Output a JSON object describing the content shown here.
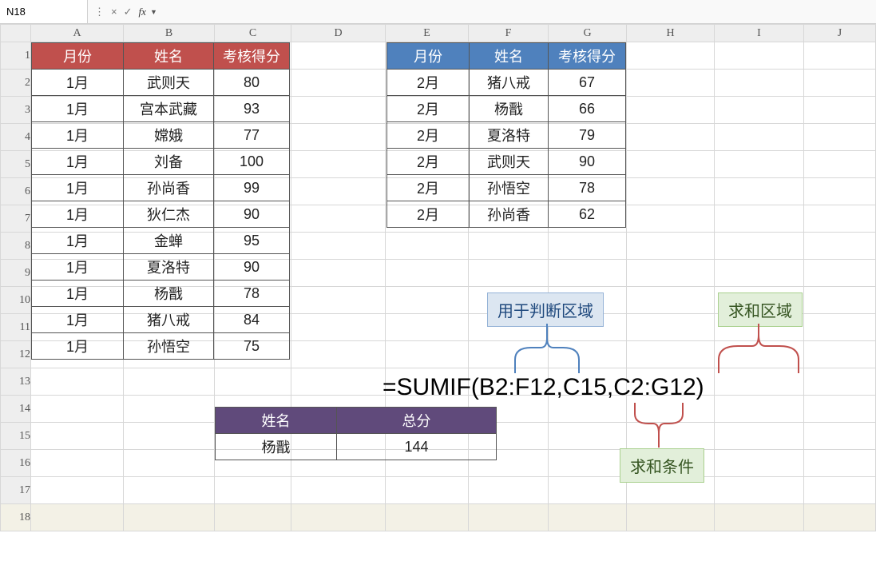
{
  "namebox": {
    "cell_ref": "N18"
  },
  "formula_bar": {
    "value": ""
  },
  "columns": [
    "A",
    "B",
    "C",
    "D",
    "E",
    "F",
    "G",
    "H",
    "I",
    "J"
  ],
  "rows": [
    "1",
    "2",
    "3",
    "4",
    "5",
    "6",
    "7",
    "8",
    "9",
    "10",
    "11",
    "12",
    "13",
    "14",
    "15",
    "16",
    "17",
    "18"
  ],
  "table1": {
    "headers": [
      "月份",
      "姓名",
      "考核得分"
    ],
    "rows": [
      [
        "1月",
        "武则天",
        "80"
      ],
      [
        "1月",
        "宫本武藏",
        "93"
      ],
      [
        "1月",
        "嫦娥",
        "77"
      ],
      [
        "1月",
        "刘备",
        "100"
      ],
      [
        "1月",
        "孙尚香",
        "99"
      ],
      [
        "1月",
        "狄仁杰",
        "90"
      ],
      [
        "1月",
        "金蝉",
        "95"
      ],
      [
        "1月",
        "夏洛特",
        "90"
      ],
      [
        "1月",
        "杨戬",
        "78"
      ],
      [
        "1月",
        "猪八戒",
        "84"
      ],
      [
        "1月",
        "孙悟空",
        "75"
      ]
    ]
  },
  "table2": {
    "headers": [
      "月份",
      "姓名",
      "考核得分"
    ],
    "rows": [
      [
        "2月",
        "猪八戒",
        "67"
      ],
      [
        "2月",
        "杨戬",
        "66"
      ],
      [
        "2月",
        "夏洛特",
        "79"
      ],
      [
        "2月",
        "武则天",
        "90"
      ],
      [
        "2月",
        "孙悟空",
        "78"
      ],
      [
        "2月",
        "孙尚香",
        "62"
      ]
    ]
  },
  "table3": {
    "headers": [
      "姓名",
      "总分"
    ],
    "rows": [
      [
        "杨戬",
        "144"
      ]
    ]
  },
  "annotations": {
    "criteria_range": "用于判断区域",
    "sum_range": "求和区域",
    "criteria": "求和条件"
  },
  "formula_text": "=SUMIF(B2:F12,C15,C2:G12)"
}
